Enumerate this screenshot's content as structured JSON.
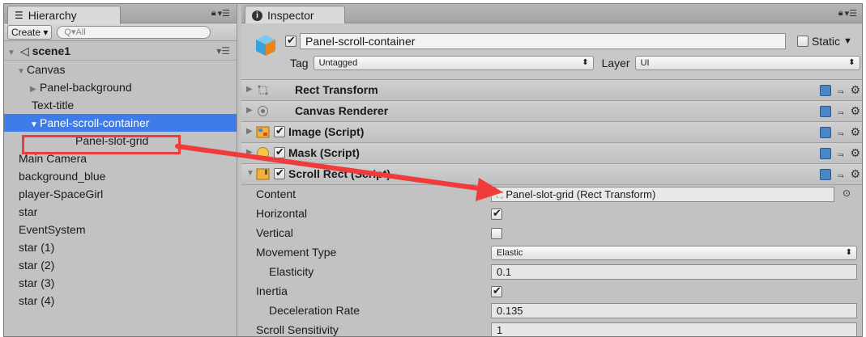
{
  "hierarchy": {
    "tab_label": "Hierarchy",
    "create_label": "Create",
    "search_placeholder": "Q▾All",
    "scene_name": "scene1",
    "items": [
      {
        "label": "Canvas",
        "indent": 1,
        "expander": "open"
      },
      {
        "label": "Panel-background",
        "indent": 2,
        "expander": "closed"
      },
      {
        "label": "Text-title",
        "indent": 2,
        "expander": "none"
      },
      {
        "label": "Panel-scroll-container",
        "indent": 2,
        "expander": "open",
        "selected": true
      },
      {
        "label": "Panel-slot-grid",
        "indent": 3,
        "expander": "none",
        "highlighted": true
      },
      {
        "label": "Main Camera",
        "indent": 1,
        "expander": "none"
      },
      {
        "label": "background_blue",
        "indent": 1,
        "expander": "none"
      },
      {
        "label": "player-SpaceGirl",
        "indent": 1,
        "expander": "none"
      },
      {
        "label": "star",
        "indent": 1,
        "expander": "none"
      },
      {
        "label": "EventSystem",
        "indent": 1,
        "expander": "none"
      },
      {
        "label": "star (1)",
        "indent": 1,
        "expander": "none"
      },
      {
        "label": "star (2)",
        "indent": 1,
        "expander": "none"
      },
      {
        "label": "star (3)",
        "indent": 1,
        "expander": "none"
      },
      {
        "label": "star (4)",
        "indent": 1,
        "expander": "none"
      }
    ]
  },
  "inspector": {
    "tab_label": "Inspector",
    "object_name": "Panel-scroll-container",
    "object_active": true,
    "static_label": "Static",
    "tag_label": "Tag",
    "tag_value": "Untagged",
    "layer_label": "Layer",
    "layer_value": "UI",
    "components": [
      {
        "title": "Rect Transform",
        "checkbox": false,
        "icon": "rect-transform-icon"
      },
      {
        "title": "Canvas Renderer",
        "checkbox": false,
        "icon": "canvas-renderer-icon"
      },
      {
        "title": "Image (Script)",
        "checkbox": true,
        "icon": "image-script-icon"
      },
      {
        "title": "Mask (Script)",
        "checkbox": true,
        "icon": "mask-script-icon"
      },
      {
        "title": "Scroll Rect (Script)",
        "checkbox": true,
        "icon": "scroll-rect-icon"
      }
    ],
    "scroll_rect": {
      "content_label": "Content",
      "content_value": "Panel-slot-grid (Rect Transform)",
      "horizontal_label": "Horizontal",
      "horizontal_value": true,
      "vertical_label": "Vertical",
      "vertical_value": false,
      "movement_type_label": "Movement Type",
      "movement_type_value": "Elastic",
      "elasticity_label": "Elasticity",
      "elasticity_value": "0.1",
      "inertia_label": "Inertia",
      "inertia_value": true,
      "deceleration_label": "Deceleration Rate",
      "deceleration_value": "0.135",
      "scroll_sensitivity_label": "Scroll Sensitivity",
      "scroll_sensitivity_value": "1"
    }
  },
  "colors": {
    "selection": "#3e7de9",
    "annotation": "#ef3b3b",
    "panel_bg": "#c2c2c2"
  }
}
